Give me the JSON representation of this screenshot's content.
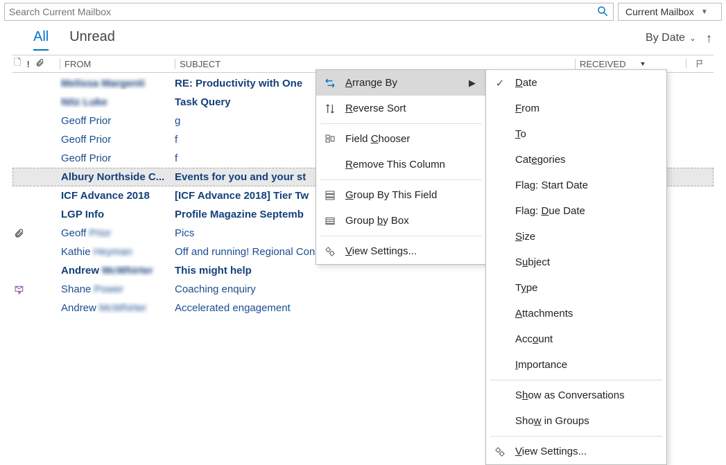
{
  "search": {
    "placeholder": "Search Current Mailbox",
    "scope_label": "Current Mailbox"
  },
  "tabs": {
    "all": "All",
    "unread": "Unread"
  },
  "sort": {
    "by_label": "By Date"
  },
  "columns": {
    "from": "FROM",
    "subject": "SUBJECT",
    "received": "RECEIVED"
  },
  "messages": [
    {
      "from": "Melissa Margenti",
      "subject": "RE: Productivity with One",
      "unread": true,
      "blur": true
    },
    {
      "from": "Nitz Luke",
      "subject": "Task Query",
      "unread": true,
      "blur": true
    },
    {
      "from": "Geoff Prior",
      "subject": "g",
      "unread": false
    },
    {
      "from": "Geoff Prior",
      "subject": "f",
      "unread": false
    },
    {
      "from": "Geoff Prior",
      "subject": "f",
      "unread": false
    },
    {
      "from": "Albury Northside C...",
      "subject": "Events for you and your st",
      "unread": true,
      "selected": true
    },
    {
      "from": "ICF Advance 2018",
      "subject": "[ICF Advance 2018] Tier Tw",
      "unread": true
    },
    {
      "from": "LGP Info",
      "subject": "Profile Magazine Septemb",
      "unread": true
    },
    {
      "from": "Geoff Prior",
      "subject": "Pics",
      "unread": false,
      "attachment": true,
      "blur_tail": true
    },
    {
      "from": "Kathie Heyman",
      "subject": "Off and running! Regional Consultants Group",
      "unread": false,
      "blur_tail": true
    },
    {
      "from": "Andrew McWhirter",
      "subject": "This might help",
      "unread": true,
      "blur_tail": true
    },
    {
      "from": "Shane Power",
      "subject": "Coaching enquiry",
      "unread": false,
      "reply": true,
      "blur_tail": true
    },
    {
      "from": "Andrew McWhirter",
      "subject": "Accelerated engagement",
      "unread": false,
      "blur_tail": true
    }
  ],
  "context1": {
    "arrange_by": "Arrange By",
    "reverse_sort": "Reverse Sort",
    "field_chooser": "Field Chooser",
    "remove_column": "Remove This Column",
    "group_by_field": "Group By This Field",
    "group_by_box": "Group by Box",
    "view_settings": "View Settings..."
  },
  "context2": {
    "date": "Date",
    "from": "From",
    "to": "To",
    "categories": "Categories",
    "flag_start": "Flag: Start Date",
    "flag_due": "Flag: Due Date",
    "size": "Size",
    "subject": "Subject",
    "type": "Type",
    "attachments": "Attachments",
    "account": "Account",
    "importance": "Importance",
    "show_conv": "Show as Conversations",
    "show_groups": "Show in Groups",
    "view_settings": "View Settings..."
  },
  "underline_map": {
    "arrange_by": "A",
    "reverse_sort": "R",
    "field_chooser": "C",
    "remove_column": "R",
    "group_by_field": "G",
    "group_by_box": "b",
    "view_settings": "V",
    "date": "D",
    "from": "F",
    "to": "T",
    "categories": "e",
    "size": "S",
    "subject": "u",
    "type": "y",
    "attachments": "A",
    "account": "o",
    "importance": "I",
    "show_conv": "h",
    "show_groups": "w"
  }
}
